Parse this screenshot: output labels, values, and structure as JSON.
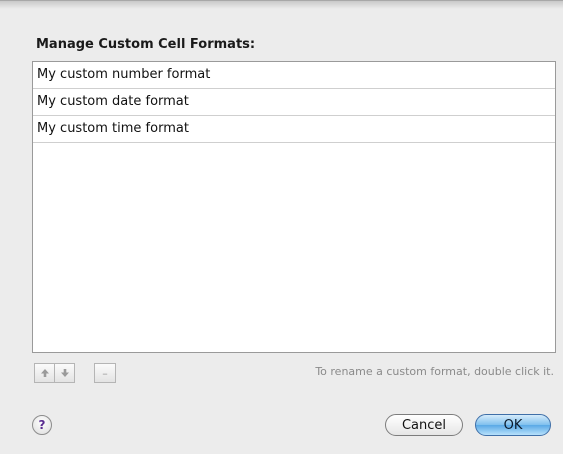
{
  "dialog": {
    "title": "Manage Custom Cell Formats:"
  },
  "formats": [
    "My custom number format",
    "My custom date format",
    "My custom time format"
  ],
  "toolbar": {
    "move_up_icon": "arrow-up-icon",
    "move_down_icon": "arrow-down-icon",
    "remove_label": "–",
    "hint": "To rename a custom format, double click it."
  },
  "buttons": {
    "help_label": "?",
    "cancel_label": "Cancel",
    "ok_label": "OK"
  },
  "colors": {
    "default_button_accent": "#5aa9e6",
    "disabled_glyph": "#9a9a9a"
  }
}
